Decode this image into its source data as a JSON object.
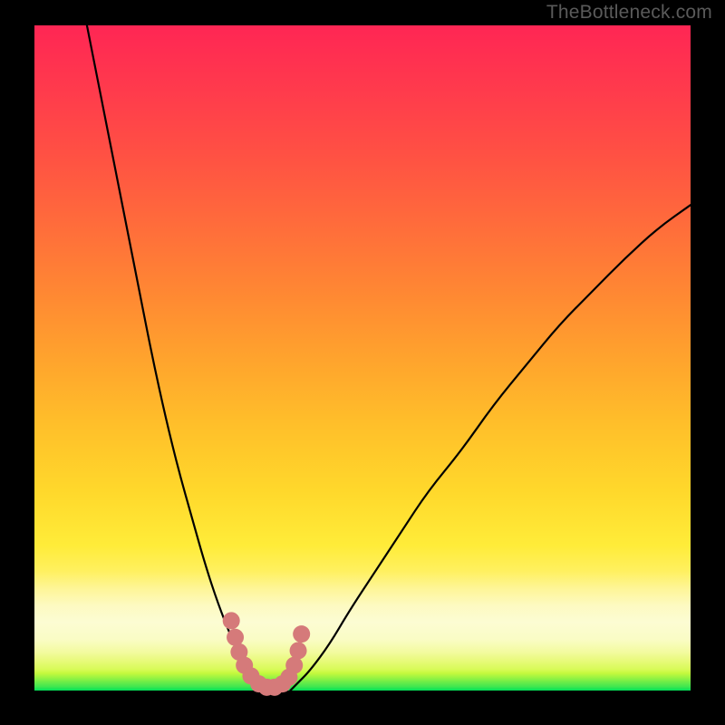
{
  "watermark": "TheBottleneck.com",
  "chart_data": {
    "type": "line",
    "title": "",
    "xlabel": "",
    "ylabel": "",
    "xlim": [
      0,
      100
    ],
    "ylim": [
      0,
      100
    ],
    "annotations": [],
    "series": [
      {
        "name": "left-curve",
        "x": [
          8,
          10,
          12,
          14,
          16,
          18,
          20,
          22,
          24,
          26,
          28,
          30,
          31,
          32,
          33,
          34,
          34.5
        ],
        "y": [
          100,
          90,
          80,
          70,
          60,
          50,
          41,
          33,
          26,
          19,
          13,
          8,
          6,
          4,
          2,
          1,
          0
        ]
      },
      {
        "name": "right-curve",
        "x": [
          39,
          40,
          42,
          45,
          48,
          52,
          56,
          60,
          65,
          70,
          75,
          80,
          85,
          90,
          95,
          100
        ],
        "y": [
          0,
          1,
          3,
          7,
          12,
          18,
          24,
          30,
          36,
          43,
          49,
          55,
          60,
          65,
          69.5,
          73
        ]
      }
    ],
    "highlight_points": {
      "name": "bottleneck-dots",
      "x": [
        30,
        30.6,
        31.2,
        32,
        33,
        34.2,
        35.4,
        36.6,
        37.8,
        38.8,
        39.6,
        40.2,
        40.7
      ],
      "y": [
        10.5,
        8,
        5.8,
        3.8,
        2.2,
        1,
        0.5,
        0.5,
        1,
        2,
        3.8,
        6,
        8.5
      ]
    },
    "gradient_stops": [
      {
        "offset": 0.0,
        "color": "#00e158"
      },
      {
        "offset": 0.006,
        "color": "#41e74f"
      },
      {
        "offset": 0.013,
        "color": "#6ded48"
      },
      {
        "offset": 0.019,
        "color": "#97f342"
      },
      {
        "offset": 0.026,
        "color": "#c4f93d"
      },
      {
        "offset": 0.032,
        "color": "#d8fa58"
      },
      {
        "offset": 0.045,
        "color": "#e8fa7b"
      },
      {
        "offset": 0.058,
        "color": "#f3fba0"
      },
      {
        "offset": 0.077,
        "color": "#fafcc5"
      },
      {
        "offset": 0.103,
        "color": "#fcfcd3"
      },
      {
        "offset": 0.128,
        "color": "#fdfac1"
      },
      {
        "offset": 0.154,
        "color": "#fef596"
      },
      {
        "offset": 0.18,
        "color": "#fff05f"
      },
      {
        "offset": 0.218,
        "color": "#ffec39"
      },
      {
        "offset": 0.3,
        "color": "#ffd82b"
      },
      {
        "offset": 0.4,
        "color": "#ffbf2a"
      },
      {
        "offset": 0.5,
        "color": "#ffa32d"
      },
      {
        "offset": 0.6,
        "color": "#ff8733"
      },
      {
        "offset": 0.7,
        "color": "#ff6c3b"
      },
      {
        "offset": 0.8,
        "color": "#ff5243"
      },
      {
        "offset": 0.9,
        "color": "#ff3b4c"
      },
      {
        "offset": 1.0,
        "color": "#ff2654"
      }
    ],
    "frame": {
      "outer_w": 800,
      "outer_h": 800,
      "inner_x": 38,
      "inner_y": 28,
      "inner_w": 724,
      "inner_h": 734
    }
  }
}
